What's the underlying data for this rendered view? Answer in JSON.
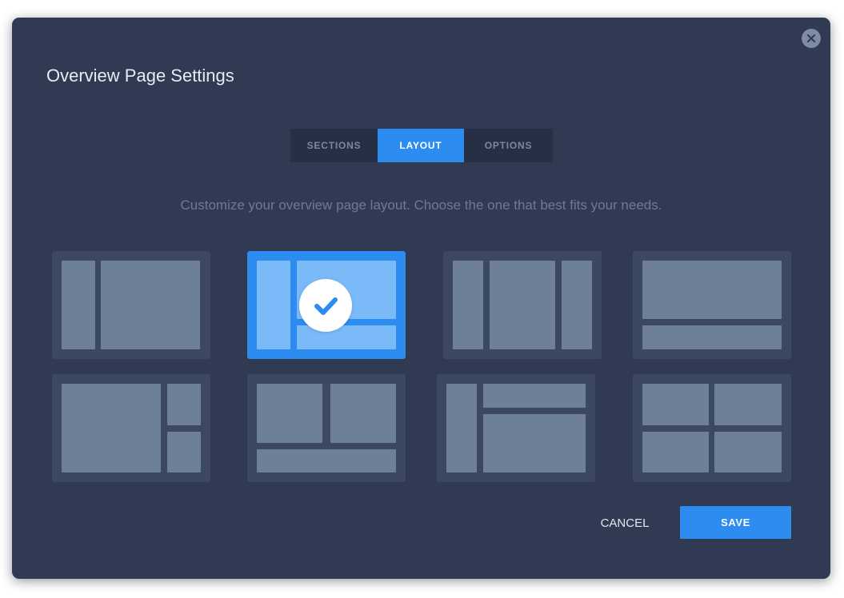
{
  "dialog": {
    "title": "Overview Page Settings",
    "close_icon": "close-icon"
  },
  "tabs": [
    {
      "label": "SECTIONS",
      "active": false
    },
    {
      "label": "LAYOUT",
      "active": true
    },
    {
      "label": "OPTIONS",
      "active": false
    }
  ],
  "description": "Customize your overview page  layout. Choose the one that best fits your needs.",
  "layouts": [
    {
      "name": "narrow-left-wide-right",
      "selected": false
    },
    {
      "name": "sidebar-with-split-main",
      "selected": true,
      "icon": "checkmark-icon"
    },
    {
      "name": "three-columns",
      "selected": false
    },
    {
      "name": "wide-top-narrow-bottom",
      "selected": false
    },
    {
      "name": "wide-left-two-stacked-right",
      "selected": false
    },
    {
      "name": "two-top-one-bottom",
      "selected": false
    },
    {
      "name": "left-column-two-right-rows",
      "selected": false
    },
    {
      "name": "four-grid",
      "selected": false
    }
  ],
  "footer": {
    "cancel_label": "CANCEL",
    "save_label": "SAVE"
  },
  "colors": {
    "modal_background": "#303a52",
    "accent": "#2d8cf0",
    "card_background": "#3c4761",
    "block": "#6e7f98",
    "selected_block": "#7bbaf9"
  }
}
